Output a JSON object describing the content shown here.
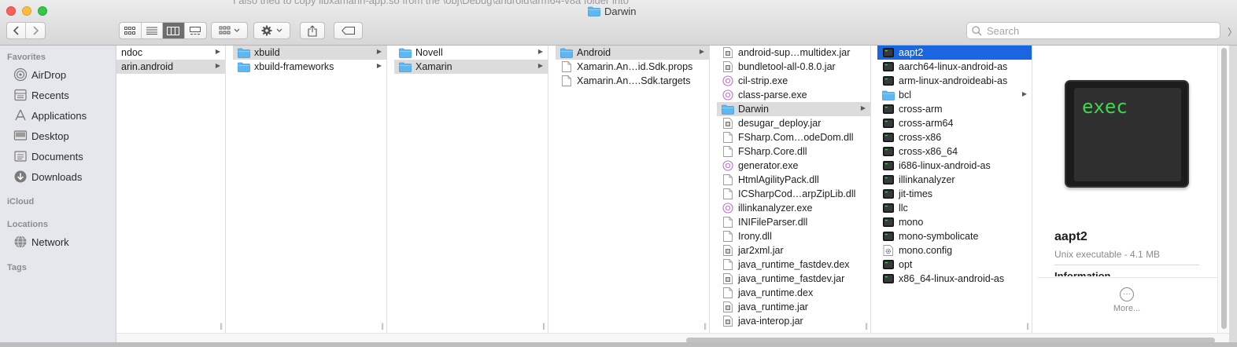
{
  "background_text": "I also tried to copy libxamarin-app.so from the \\obj\\Debug\\android\\arm64-v8a folder into",
  "window": {
    "title": "Darwin"
  },
  "toolbar": {
    "search_placeholder": "Search"
  },
  "sidebar": {
    "favorites_label": "Favorites",
    "favorites": [
      {
        "label": "AirDrop",
        "icon": "airdrop-icon"
      },
      {
        "label": "Recents",
        "icon": "recents-icon"
      },
      {
        "label": "Applications",
        "icon": "applications-icon"
      },
      {
        "label": "Desktop",
        "icon": "desktop-icon"
      },
      {
        "label": "Documents",
        "icon": "documents-icon"
      },
      {
        "label": "Downloads",
        "icon": "downloads-icon"
      }
    ],
    "icloud_label": "iCloud",
    "locations_label": "Locations",
    "locations": [
      {
        "label": "Network",
        "icon": "network-icon"
      }
    ],
    "tags_label": "Tags"
  },
  "columns": [
    {
      "items": [
        {
          "name": "ndoc",
          "type": "folder-hidden",
          "arrow": true
        },
        {
          "name": "arin.android",
          "type": "folder-hidden",
          "arrow": true,
          "selected": "gray"
        }
      ]
    },
    {
      "items": [
        {
          "name": "xbuild",
          "type": "folder",
          "arrow": true,
          "selected": "gray"
        },
        {
          "name": "xbuild-frameworks",
          "type": "folder",
          "arrow": true
        }
      ]
    },
    {
      "items": [
        {
          "name": "Novell",
          "type": "folder",
          "arrow": true
        },
        {
          "name": "Xamarin",
          "type": "folder",
          "arrow": true,
          "selected": "gray"
        }
      ]
    },
    {
      "items": [
        {
          "name": "Android",
          "type": "folder",
          "arrow": true,
          "selected": "gray"
        },
        {
          "name": "Xamarin.An…id.Sdk.props",
          "type": "doc"
        },
        {
          "name": "Xamarin.An….Sdk.targets",
          "type": "doc"
        }
      ]
    },
    {
      "items": [
        {
          "name": "android-sup…multidex.jar",
          "type": "jar"
        },
        {
          "name": "bundletool-all-0.8.0.jar",
          "type": "jar"
        },
        {
          "name": "cil-strip.exe",
          "type": "exe"
        },
        {
          "name": "class-parse.exe",
          "type": "exe"
        },
        {
          "name": "Darwin",
          "type": "folder",
          "arrow": true,
          "selected": "gray"
        },
        {
          "name": "desugar_deploy.jar",
          "type": "jar"
        },
        {
          "name": "FSharp.Com…odeDom.dll",
          "type": "doc"
        },
        {
          "name": "FSharp.Core.dll",
          "type": "doc"
        },
        {
          "name": "generator.exe",
          "type": "exe"
        },
        {
          "name": "HtmlAgilityPack.dll",
          "type": "doc"
        },
        {
          "name": "ICSharpCod…arpZipLib.dll",
          "type": "doc"
        },
        {
          "name": "illinkanalyzer.exe",
          "type": "exe"
        },
        {
          "name": "INIFileParser.dll",
          "type": "doc"
        },
        {
          "name": "Irony.dll",
          "type": "doc"
        },
        {
          "name": "jar2xml.jar",
          "type": "jar"
        },
        {
          "name": "java_runtime_fastdev.dex",
          "type": "doc"
        },
        {
          "name": "java_runtime_fastdev.jar",
          "type": "jar"
        },
        {
          "name": "java_runtime.dex",
          "type": "doc"
        },
        {
          "name": "java_runtime.jar",
          "type": "jar"
        },
        {
          "name": "java-interop.jar",
          "type": "jar"
        }
      ]
    },
    {
      "items": [
        {
          "name": "aapt2",
          "type": "exec",
          "selected": "blue"
        },
        {
          "name": "aarch64-linux-android-as",
          "type": "exec"
        },
        {
          "name": "arm-linux-androideabi-as",
          "type": "exec"
        },
        {
          "name": "bcl",
          "type": "folder",
          "arrow": true
        },
        {
          "name": "cross-arm",
          "type": "exec"
        },
        {
          "name": "cross-arm64",
          "type": "exec"
        },
        {
          "name": "cross-x86",
          "type": "exec"
        },
        {
          "name": "cross-x86_64",
          "type": "exec"
        },
        {
          "name": "i686-linux-android-as",
          "type": "exec"
        },
        {
          "name": "illinkanalyzer",
          "type": "exec"
        },
        {
          "name": "jit-times",
          "type": "exec"
        },
        {
          "name": "llc",
          "type": "exec"
        },
        {
          "name": "mono",
          "type": "exec"
        },
        {
          "name": "mono-symbolicate",
          "type": "exec"
        },
        {
          "name": "mono.config",
          "type": "config"
        },
        {
          "name": "opt",
          "type": "exec"
        },
        {
          "name": "x86_64-linux-android-as",
          "type": "exec"
        }
      ]
    }
  ],
  "preview": {
    "thumbnail_text": "exec",
    "name": "aapt2",
    "kind": "Unix executable - 4.1 MB",
    "info_heading": "Information",
    "more_label": "More..."
  },
  "colors": {
    "selection_blue": "#1966e0",
    "selection_gray": "#dcdcdc",
    "folder_blue": "#5fb6f0",
    "exec_green": "#3cd94c"
  }
}
